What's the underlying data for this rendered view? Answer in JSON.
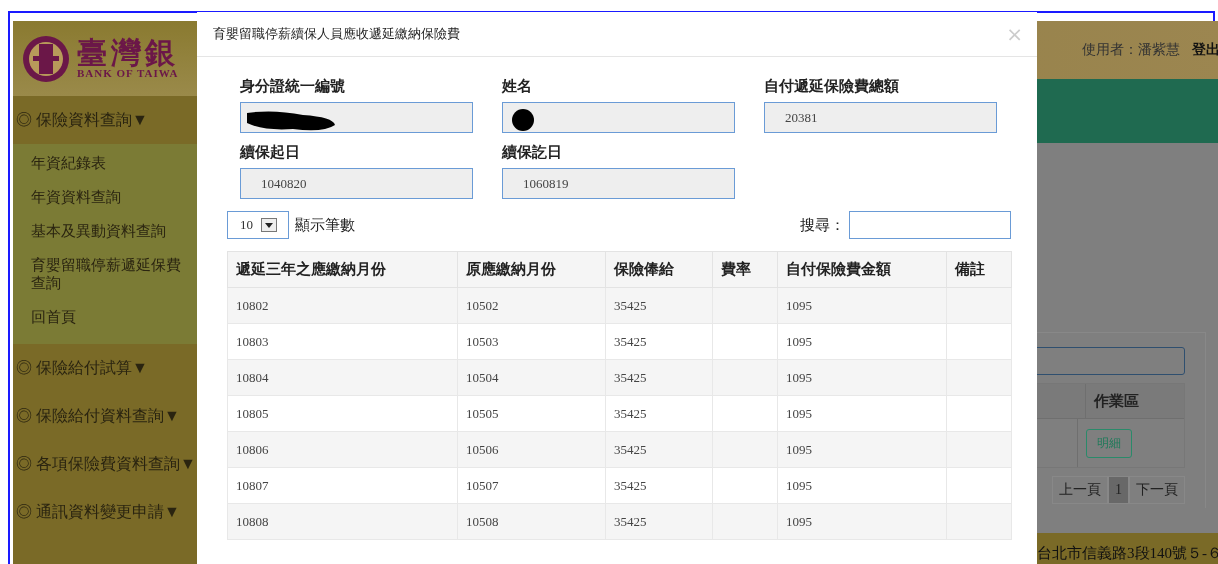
{
  "logo": {
    "name": "臺灣銀",
    "english": "BANK OF TAIWA"
  },
  "user_bar": {
    "user": "使用者：潘紫慧",
    "logout": "登出"
  },
  "sidebar": {
    "groups": [
      {
        "prefix": "◎",
        "label": "保險資料查詢",
        "caret": "▼",
        "children": [
          {
            "label": "年資紀錄表"
          },
          {
            "label": "年資資料查詢"
          },
          {
            "label": "基本及異動資料查詢"
          },
          {
            "label": "育嬰留職停薪遞延保費查詢"
          },
          {
            "label": "回首頁"
          }
        ]
      },
      {
        "prefix": "◎",
        "label": "保險給付試算",
        "caret": "▼"
      },
      {
        "prefix": "◎",
        "label": "保險給付資料查詢",
        "caret": "▼"
      },
      {
        "prefix": "◎",
        "label": "各項保險費資料查詢",
        "caret": "▼"
      },
      {
        "prefix": "◎",
        "label": "通訊資料變更申請",
        "caret": "▼"
      }
    ]
  },
  "background_panel": {
    "column": "作業區",
    "row_button": "明細",
    "pagination": [
      {
        "label": "上一頁",
        "selected": false
      },
      {
        "label": "1",
        "selected": true
      },
      {
        "label": "下一頁",
        "selected": false
      }
    ]
  },
  "footer": {
    "address": "台北市信義路3段140號５-６"
  },
  "modal": {
    "title": "育嬰留職停薪續保人員應收遞延繳納保險費",
    "close": "×",
    "fields": [
      {
        "label": "身分證統一編號",
        "redacted": true
      },
      {
        "label": "姓名",
        "redacted": true
      },
      {
        "label": "自付遞延保險費總額",
        "value": "20381",
        "redacted": false
      },
      {
        "label": "續保起日",
        "value": "1040820",
        "redacted": false
      },
      {
        "label": "續保訖日",
        "value": "1060819",
        "redacted": false
      }
    ],
    "page_size": "10",
    "page_size_label": "顯示筆數",
    "search_label": "搜尋：",
    "table": {
      "columns": [
        "遞延三年之應繳納月份",
        "原應繳納月份",
        "保險俸給",
        "費率",
        "自付保險費金額",
        "備註"
      ],
      "rows": [
        [
          "10802",
          "10502",
          "35425",
          "",
          "1095",
          ""
        ],
        [
          "10803",
          "10503",
          "35425",
          "",
          "1095",
          ""
        ],
        [
          "10804",
          "10504",
          "35425",
          "",
          "1095",
          ""
        ],
        [
          "10805",
          "10505",
          "35425",
          "",
          "1095",
          ""
        ],
        [
          "10806",
          "10506",
          "35425",
          "",
          "1095",
          ""
        ],
        [
          "10807",
          "10507",
          "35425",
          "",
          "1095",
          ""
        ],
        [
          "10808",
          "10508",
          "35425",
          "",
          "1095",
          ""
        ]
      ]
    }
  }
}
